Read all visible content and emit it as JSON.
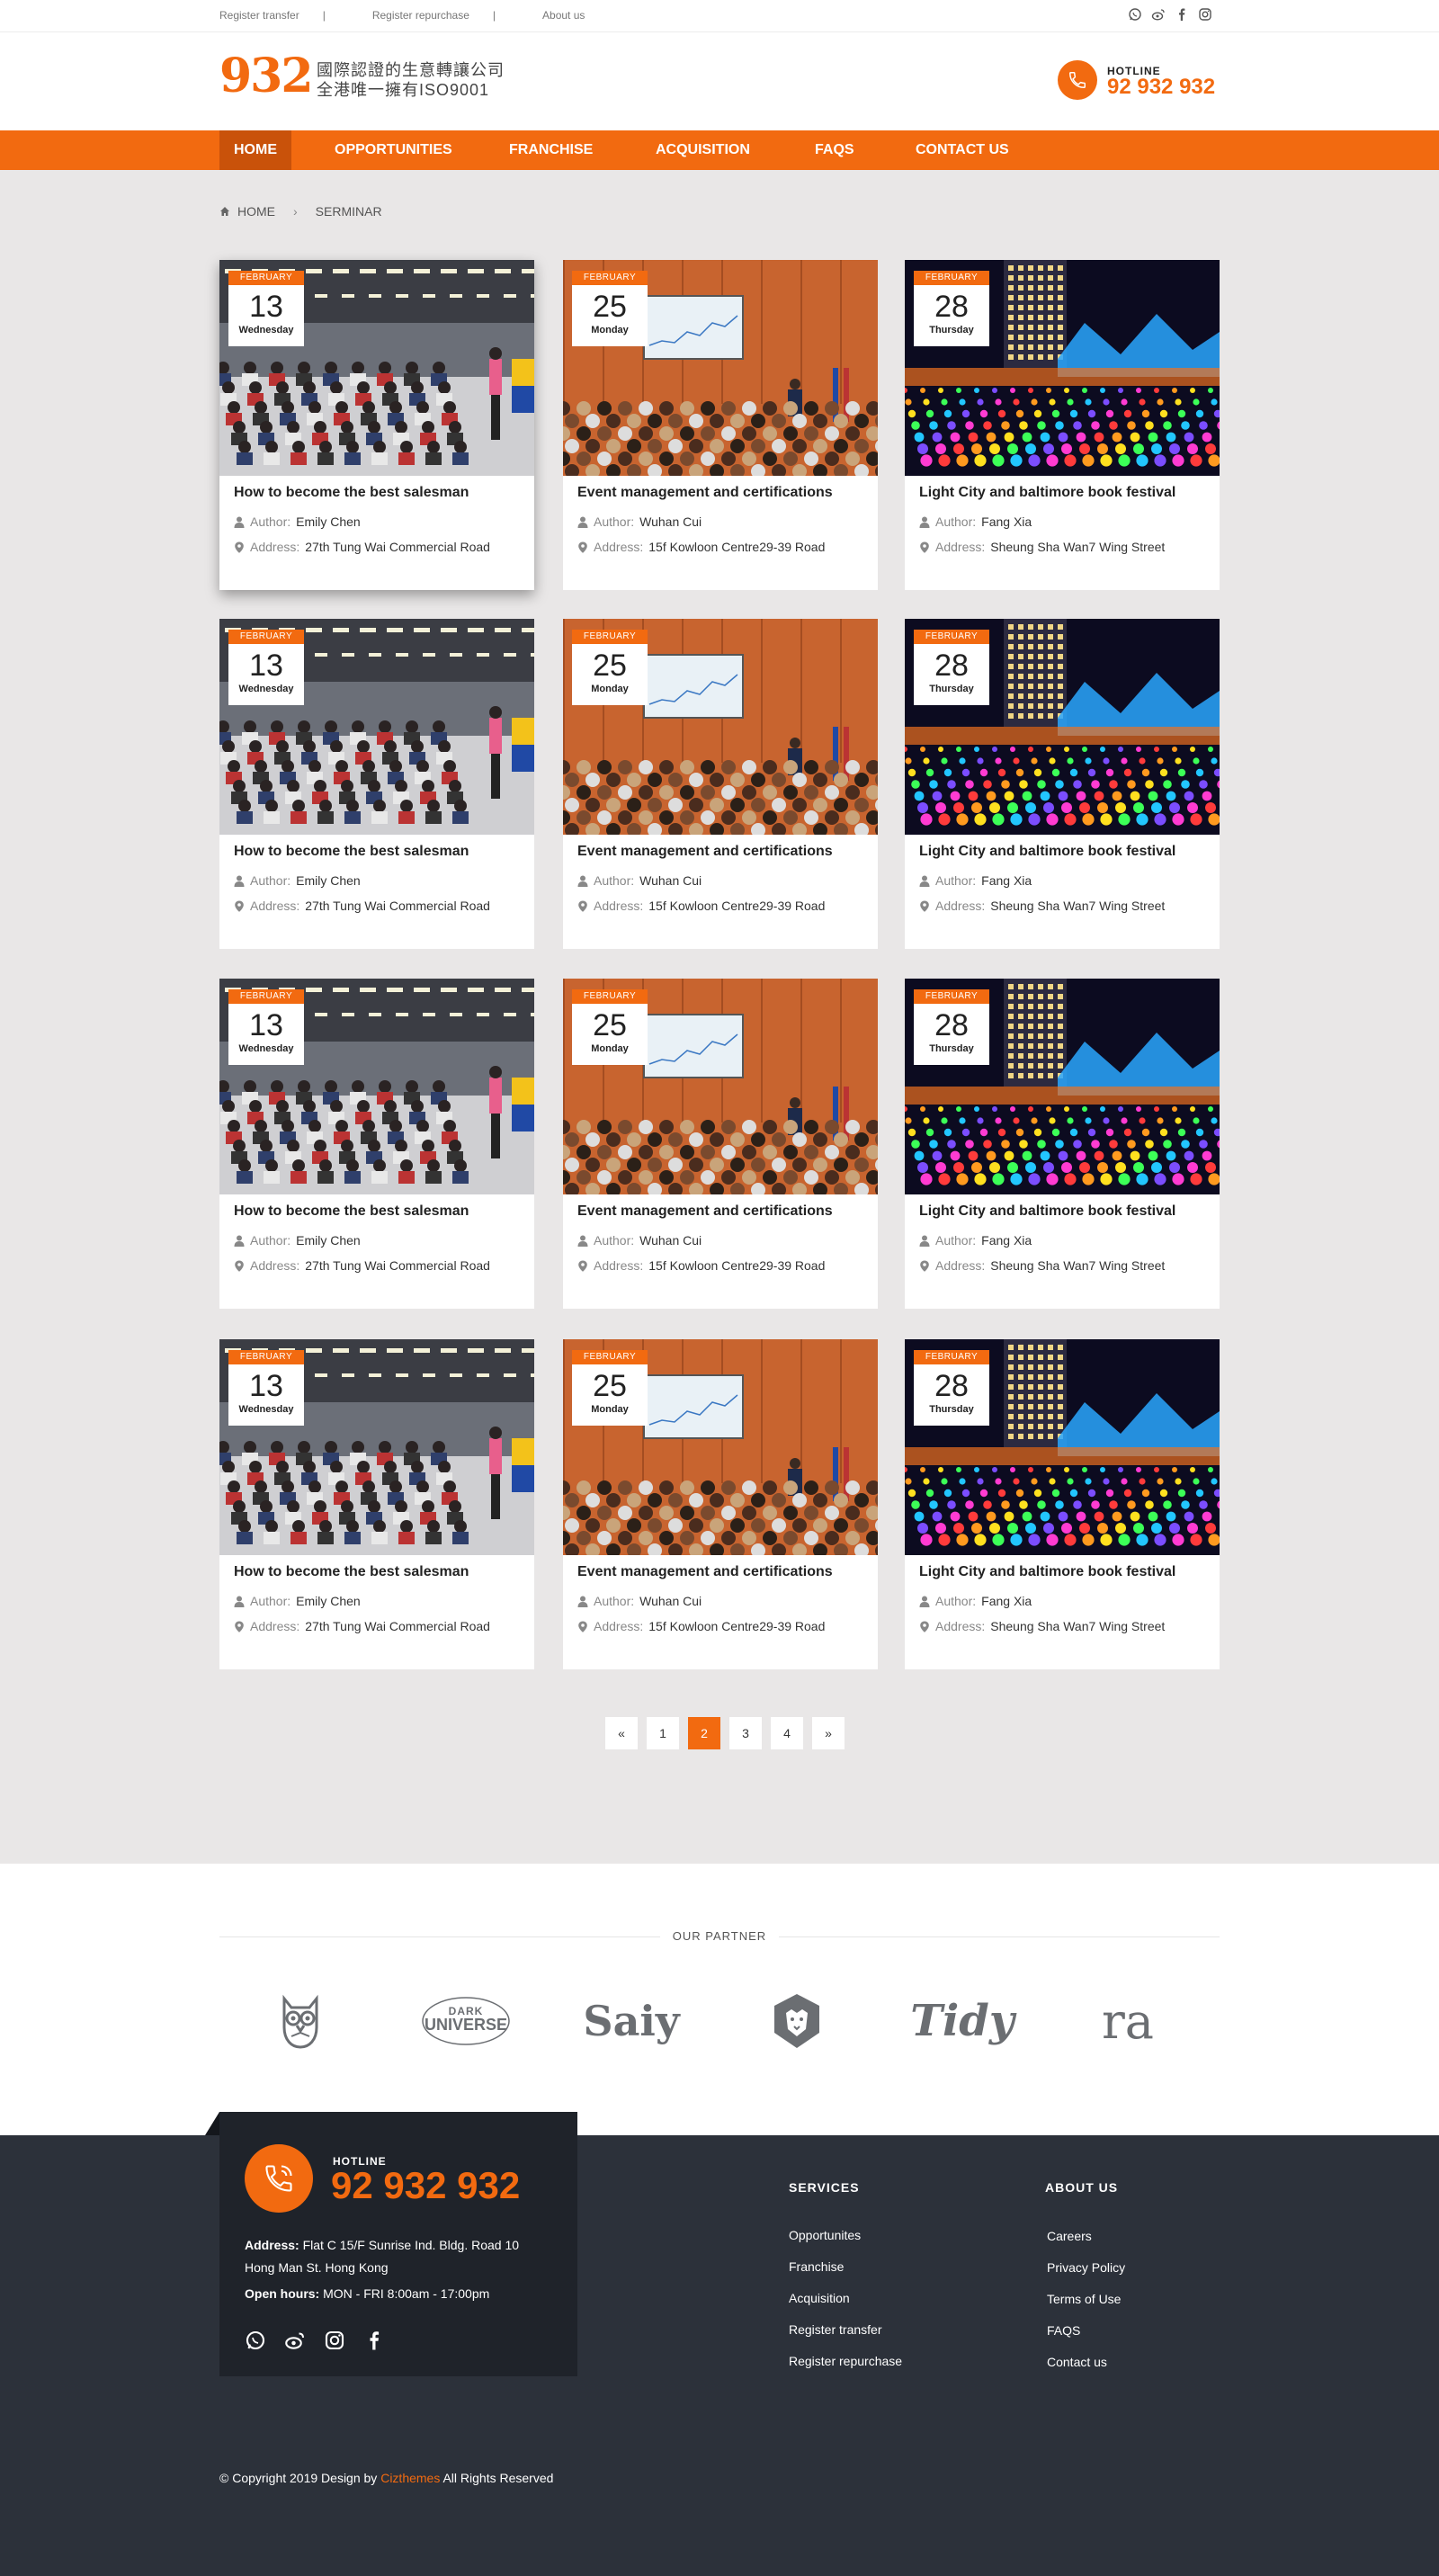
{
  "topbar": {
    "links": [
      "Register transfer",
      "Register repurchase",
      "About us"
    ],
    "social_icons": [
      "whatsapp-icon",
      "weibo-icon",
      "facebook-icon",
      "instagram-icon"
    ]
  },
  "header": {
    "logo_number": "932",
    "logo_line1": "國際認證的生意轉讓公司",
    "logo_line2": "全港唯一擁有ISO9001",
    "hotline_label": "HOTLINE",
    "hotline_number": "92 932 932"
  },
  "nav": {
    "items": [
      "HOME",
      "OPPORTUNITIES",
      "FRANCHISE",
      "ACQUISITION",
      "FAQS",
      "CONTACT US"
    ],
    "active": "HOME"
  },
  "breadcrumb": {
    "home": "HOME",
    "current": "SERMINAR"
  },
  "meta_labels": {
    "author": "Author:",
    "address": "Address:"
  },
  "events": [
    {
      "month": "FEBRUARY",
      "day": "13",
      "weekday": "Wednesday",
      "title": "How to become the best salesman",
      "author": "Emily Chen",
      "address": "27th Tung Wai Commercial  Road"
    },
    {
      "month": "FEBRUARY",
      "day": "25",
      "weekday": "Monday",
      "title": "Event management and certifications",
      "author": "Wuhan  Cui",
      "address": "15f Kowloon Centre29-39 Road"
    },
    {
      "month": "FEBRUARY",
      "day": "28",
      "weekday": "Thursday",
      "title": "Light City and baltimore book festival",
      "author": "Fang  Xia",
      "address": "Sheung Sha Wan7 Wing Street"
    }
  ],
  "pagination": {
    "prev": "«",
    "pages": [
      "1",
      "2",
      "3",
      "4"
    ],
    "current": "2",
    "next": "»"
  },
  "partners": {
    "title": "OUR PARTNER",
    "logos": [
      "owl-logo",
      "Dark Universe",
      "Saiy",
      "lion-logo",
      "Tidy",
      "ra"
    ],
    "dark_universe_top": "DARK",
    "dark_universe_bottom": "UNIVERSE"
  },
  "footer": {
    "hotline_label": "HOTLINE",
    "hotline_number": "92 932 932",
    "address_label": "Address:",
    "address_value": "Flat C 15/F Sunrise Ind. Bldg.  Road 10 Hong Man St. Hong Kong",
    "hours_label": "Open hours:",
    "hours_value": "MON - FRI  8:00am - 17:00pm",
    "services_title": "SERVICES",
    "services": [
      "Opportunites",
      "Franchise",
      "Acquisition",
      "Register transfer",
      "Register repurchase"
    ],
    "about_title": "ABOUT US",
    "about": [
      "Careers",
      "Privacy Policy",
      "Terms of Use",
      "FAQS",
      "Contact us"
    ],
    "copyright_prefix": "© Copyright 2019 Design by",
    "copyright_brand": "Cizthemes",
    "copyright_suffix": "All Rights Reserved"
  },
  "colors": {
    "accent": "#f26a10",
    "footer_bg": "#2c313a",
    "main_bg": "#e9e7e7"
  }
}
